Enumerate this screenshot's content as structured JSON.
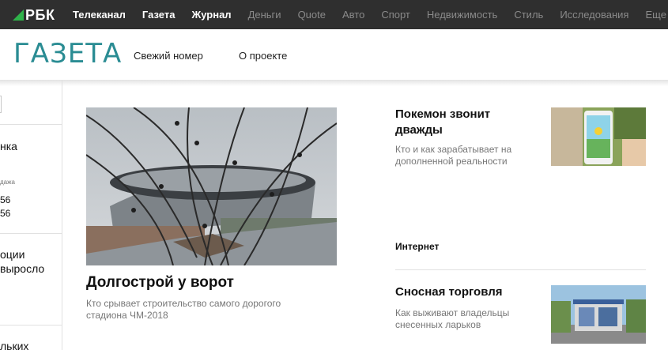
{
  "topnav": {
    "logo": "РБК",
    "links": [
      {
        "label": "Телеканал",
        "style": "bold"
      },
      {
        "label": "Газета",
        "style": "bold"
      },
      {
        "label": "Журнал",
        "style": "bold"
      },
      {
        "label": "Деньги",
        "style": "dim"
      },
      {
        "label": "Quote",
        "style": "dim"
      },
      {
        "label": "Авто",
        "style": "dim"
      },
      {
        "label": "Спорт",
        "style": "dim"
      },
      {
        "label": "Недвижимость",
        "style": "dim"
      },
      {
        "label": "Стиль",
        "style": "dim"
      },
      {
        "label": "Исследования",
        "style": "dim"
      },
      {
        "label": "Еще",
        "style": "dim"
      }
    ]
  },
  "subhead": {
    "title": "ГАЗЕТА",
    "links": [
      "Свежий номер",
      "О проекте"
    ]
  },
  "sidebar": {
    "item1": "нка",
    "small_label": "дажа",
    "num1": "56",
    "num2": "56",
    "item2_line1": "оции",
    "item2_line2": "выросло",
    "item3": "льких"
  },
  "feature": {
    "title": "Долгострой у ворот",
    "lead": "Кто срывает строительство самого дорогого стадиона ЧМ-2018"
  },
  "cards": [
    {
      "title": "Покемон звонит дважды",
      "lead": "Кто и как зарабатывает на дополненной реальности",
      "thumb": "pokemon-go-phone-photo"
    },
    {
      "title": "Сносная торговля",
      "lead": "Как выживают владельцы снесенных ларьков",
      "thumb": "street-kiosk-photo"
    }
  ],
  "rubric": "Интернет",
  "colors": {
    "topnav_bg": "#2f2f2f",
    "brand_green": "#2fb34a",
    "section_title": "#2a8c93",
    "lead_text": "#777777"
  }
}
